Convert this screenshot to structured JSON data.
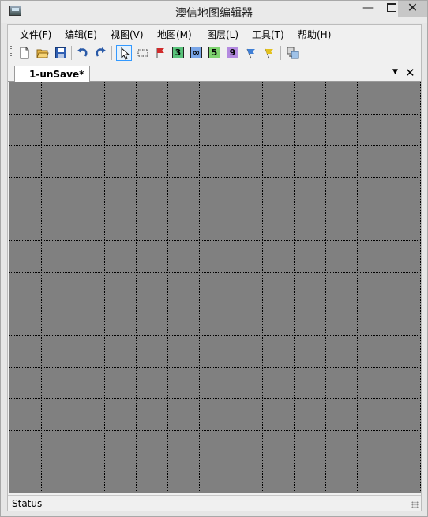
{
  "window": {
    "title": "澳信地图编辑器",
    "controls": {
      "minimize": "—",
      "close": "✕"
    }
  },
  "menu": [
    {
      "id": "file",
      "label": "文件(F)"
    },
    {
      "id": "edit",
      "label": "编辑(E)"
    },
    {
      "id": "view",
      "label": "视图(V)"
    },
    {
      "id": "map",
      "label": "地图(M)"
    },
    {
      "id": "layer",
      "label": "图层(L)"
    },
    {
      "id": "tools",
      "label": "工具(T)"
    },
    {
      "id": "help",
      "label": "帮助(H)"
    }
  ],
  "toolbar": {
    "buttons": [
      {
        "icon": "new-document-icon"
      },
      {
        "icon": "open-folder-icon"
      },
      {
        "icon": "save-disk-icon"
      },
      {
        "icon": "undo-icon"
      },
      {
        "icon": "redo-icon"
      },
      {
        "icon": "select-arrow-icon",
        "active": true
      },
      {
        "icon": "marquee-select-icon"
      },
      {
        "icon": "red-flag-icon"
      },
      {
        "icon": "layer-3-icon",
        "text": "3"
      },
      {
        "icon": "layer-infinity-icon",
        "text": "∞"
      },
      {
        "icon": "layer-5-icon",
        "text": "5"
      },
      {
        "icon": "layer-9-icon",
        "text": "9"
      },
      {
        "icon": "blue-flag-icon"
      },
      {
        "icon": "yellow-flag-icon"
      },
      {
        "icon": "export-icon"
      }
    ]
  },
  "document_tab": {
    "label": "1-unSave*"
  },
  "tab_controls": {
    "dropdown": "▼",
    "close": "✕"
  },
  "map": {
    "grid_rows": 13,
    "grid_cols": 13,
    "background": "#808080"
  },
  "status": {
    "text": "Status"
  }
}
